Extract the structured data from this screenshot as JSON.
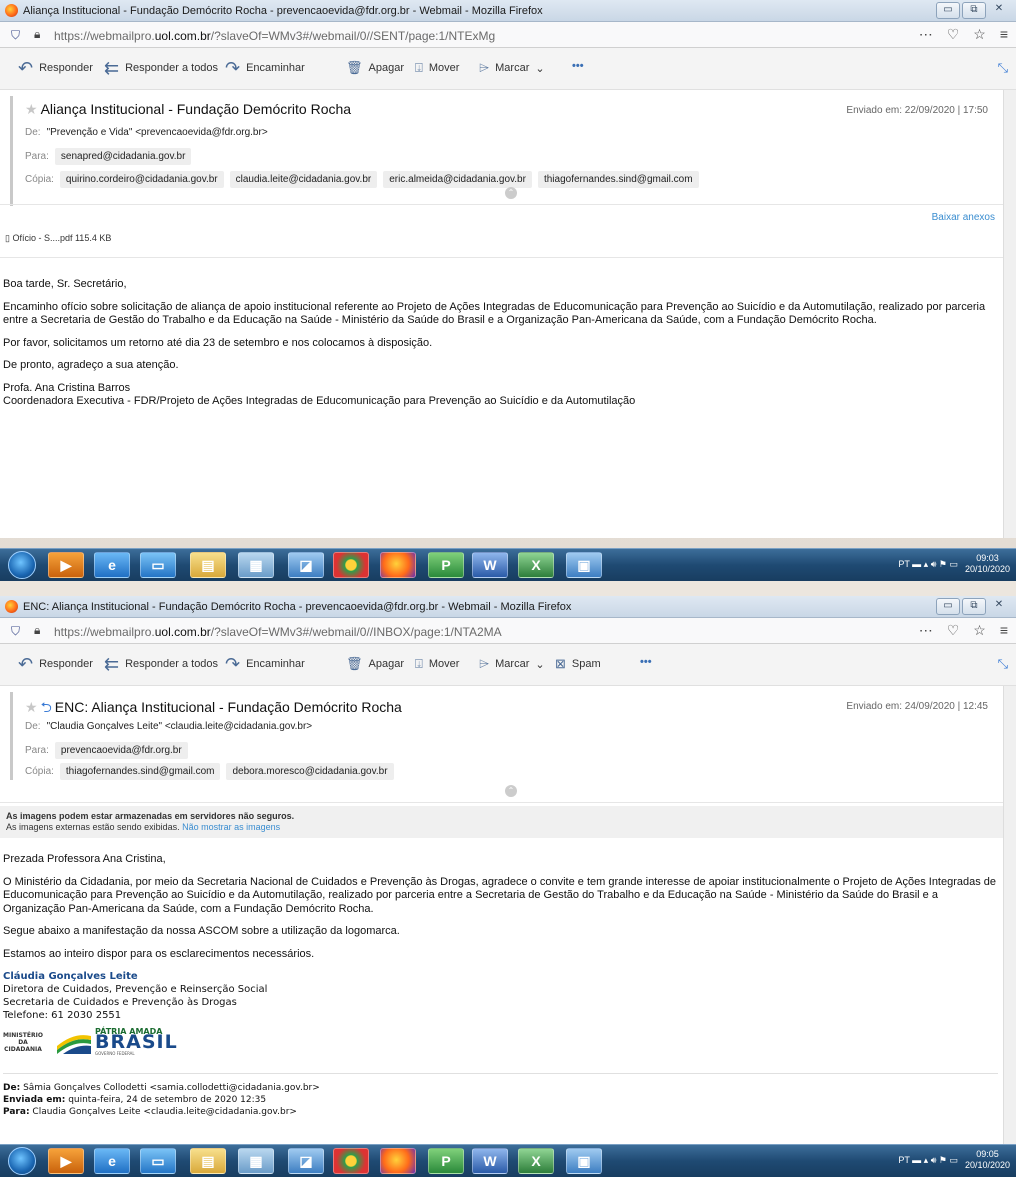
{
  "shots": [
    {
      "window_title": "Aliança Institucional - Fundação Demócrito Rocha - prevencaoevida@fdr.org.br - Webmail - Mozilla Firefox",
      "url_prefix": "https://webmailpro.",
      "url_domain": "uol.com.br",
      "url_suffix": "/?slaveOf=WMv3#/webmail/0//SENT/page:1/NTExMg",
      "toolbar": {
        "reply": "Responder",
        "reply_all": "Responder a todos",
        "forward": "Encaminhar",
        "delete": "Apagar",
        "move": "Mover",
        "mark": "Marcar",
        "more": "•••"
      },
      "subject": "Aliança Institucional - Fundação Demócrito Rocha",
      "sent_date": "Enviado em: 22/09/2020 | 17:50",
      "from_label": "De:",
      "from_value": "\"Prevenção e Vida\" <prevencaoevida@fdr.org.br>",
      "to_label": "Para:",
      "to": [
        "senapred@cidadania.gov.br"
      ],
      "cc_label": "Cópia:",
      "cc": [
        "quirino.cordeiro@cidadania.gov.br",
        "claudia.leite@cidadania.gov.br",
        "eric.almeida@cidadania.gov.br",
        "thiagofernandes.sind@gmail.com"
      ],
      "download_label": "Baixar anexos",
      "attachment": "Ofício - S....pdf  115.4 KB",
      "body": [
        "Boa tarde, Sr. Secretário,",
        "Encaminho ofício sobre solicitação de aliança de apoio institucional referente ao Projeto de Ações Integradas de Educomunicação para Prevenção ao Suicídio e da Automutilação, realizado por parceria entre a Secretaria de Gestão do Trabalho e da Educação na Saúde - Ministério da Saúde do Brasil e a Organização Pan-Americana da Saúde, com a Fundação Demócrito Rocha.",
        "Por favor, solicitamos um retorno até dia 23 de setembro e nos colocamos à disposição.",
        "De pronto, agradeço a sua atenção."
      ],
      "signature_name": "Profa. Ana Cristina Barros",
      "signature_role": "Coordenadora Executiva - FDR/Projeto de Ações Integradas de Educomunicação para Prevenção ao Suicídio e da Automutilação",
      "tray_lang": "PT",
      "clock_time": "09:03",
      "clock_date": "20/10/2020"
    },
    {
      "window_title": "ENC: Aliança Institucional - Fundação Demócrito Rocha - prevencaoevida@fdr.org.br - Webmail - Mozilla Firefox",
      "url_prefix": "https://webmailpro.",
      "url_domain": "uol.com.br",
      "url_suffix": "/?slaveOf=WMv3#/webmail/0//INBOX/page:1/NTA2MA",
      "toolbar": {
        "reply": "Responder",
        "reply_all": "Responder a todos",
        "forward": "Encaminhar",
        "delete": "Apagar",
        "move": "Mover",
        "mark": "Marcar",
        "spam": "Spam",
        "more": "•••"
      },
      "subject": "ENC: Aliança Institucional - Fundação Demócrito Rocha",
      "sent_date": "Enviado em: 24/09/2020 | 12:45",
      "from_label": "De:",
      "from_value": "\"Claudia Gonçalves Leite\" <claudia.leite@cidadania.gov.br>",
      "to_label": "Para:",
      "to": [
        "prevencaoevida@fdr.org.br"
      ],
      "cc_label": "Cópia:",
      "cc": [
        "thiagofernandes.sind@gmail.com",
        "debora.moresco@cidadania.gov.br"
      ],
      "warning_title": "As imagens podem estar armazenadas em servidores não seguros.",
      "warning_text": "As imagens externas estão sendo exibidas.",
      "warning_link": "Não mostrar as imagens",
      "body": [
        "Prezada Professora Ana Cristina,",
        "O Ministério da Cidadania, por meio da Secretaria Nacional de Cuidados e Prevenção às Drogas, agradece o convite e tem grande interesse de  apoiar institucionalmente o Projeto de Ações Integradas de Educomunicação para Prevenção ao Suicídio e da Automutilação, realizado por parceria entre a Secretaria de Gestão do Trabalho e da Educação na Saúde - Ministério da Saúde do Brasil e a Organização Pan-Americana da Saúde, com a Fundação Demócrito Rocha.",
        "Segue abaixo a manifestação da nossa ASCOM sobre a utilização da logomarca.",
        "Estamos ao inteiro dispor para os esclarecimentos necessários."
      ],
      "signature_name": "Cláudia Gonçalves Leite",
      "signature_lines": [
        "Diretora de Cuidados, Prevenção e Reinserção Social",
        "Secretaria de  Cuidados e Prevenção às Drogas",
        "Telefone: 61 2030 2551"
      ],
      "logo_ministerio": "MINISTÉRIO DA CIDADANIA",
      "logo_patria": "PÁTRIA AMADA",
      "logo_brasil": "BRASIL",
      "logo_gov": "GOVERNO FEDERAL",
      "quoted_from_label": "De:",
      "quoted_from": "Sâmia Gonçalves Collodetti <samia.collodetti@cidadania.gov.br>",
      "quoted_sent_label": "Enviada em:",
      "quoted_sent": "quinta-feira, 24 de setembro de 2020 12:35",
      "quoted_to_label": "Para:",
      "quoted_to": "Claudia Gonçalves Leite <claudia.leite@cidadania.gov.br>",
      "tray_lang": "PT",
      "clock_time": "09:05",
      "clock_date": "20/10/2020"
    }
  ],
  "taskbar_icons": [
    "ie-icon",
    "media-icon",
    "desktop-icon",
    "folder-icon",
    "notepad-icon",
    "app-icon",
    "chrome-icon",
    "firefox-icon",
    "publisher-icon",
    "word-icon",
    "excel-icon",
    "explorer-icon"
  ]
}
